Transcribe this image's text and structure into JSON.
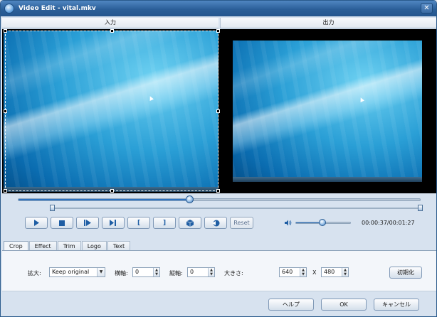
{
  "window": {
    "title": "Video Edit - vital.mkv",
    "close_label": "✕"
  },
  "panels": {
    "input_label": "入力",
    "output_label": "出力"
  },
  "playback": {
    "seek_position": 0.425,
    "trim_start": 0.0,
    "trim_end": 1.0,
    "volume_level": 0.49,
    "time_readout": "00:00:37/00:01:27",
    "reset_label": "Reset",
    "buttons": [
      "play-icon",
      "stop-icon",
      "step-forward-icon",
      "frame-step-icon",
      "mark-in-icon",
      "mark-out-icon",
      "snapshot-icon",
      "export-icon"
    ],
    "mark_in_glyph": "[",
    "mark_out_glyph": "]"
  },
  "tabs": [
    {
      "label": "Crop",
      "active": true
    },
    {
      "label": "Effect",
      "active": false
    },
    {
      "label": "Trim",
      "active": false
    },
    {
      "label": "Logo",
      "active": false
    },
    {
      "label": "Text",
      "active": false
    }
  ],
  "crop": {
    "zoom_label": "拡大:",
    "zoom_value": "Keep original",
    "horizontal_label": "横軸:",
    "horizontal_value": "0",
    "vertical_label": "縦軸:",
    "vertical_value": "0",
    "size_label": "大きさ:",
    "width_value": "640",
    "times_label": "X",
    "height_value": "480",
    "reset_label": "初期化"
  },
  "footer": {
    "help_label": "ヘルプ",
    "ok_label": "OK",
    "cancel_label": "キャンセル"
  },
  "colors": {
    "accent": "#2e73c0",
    "titlebar": "#2b5f99"
  }
}
